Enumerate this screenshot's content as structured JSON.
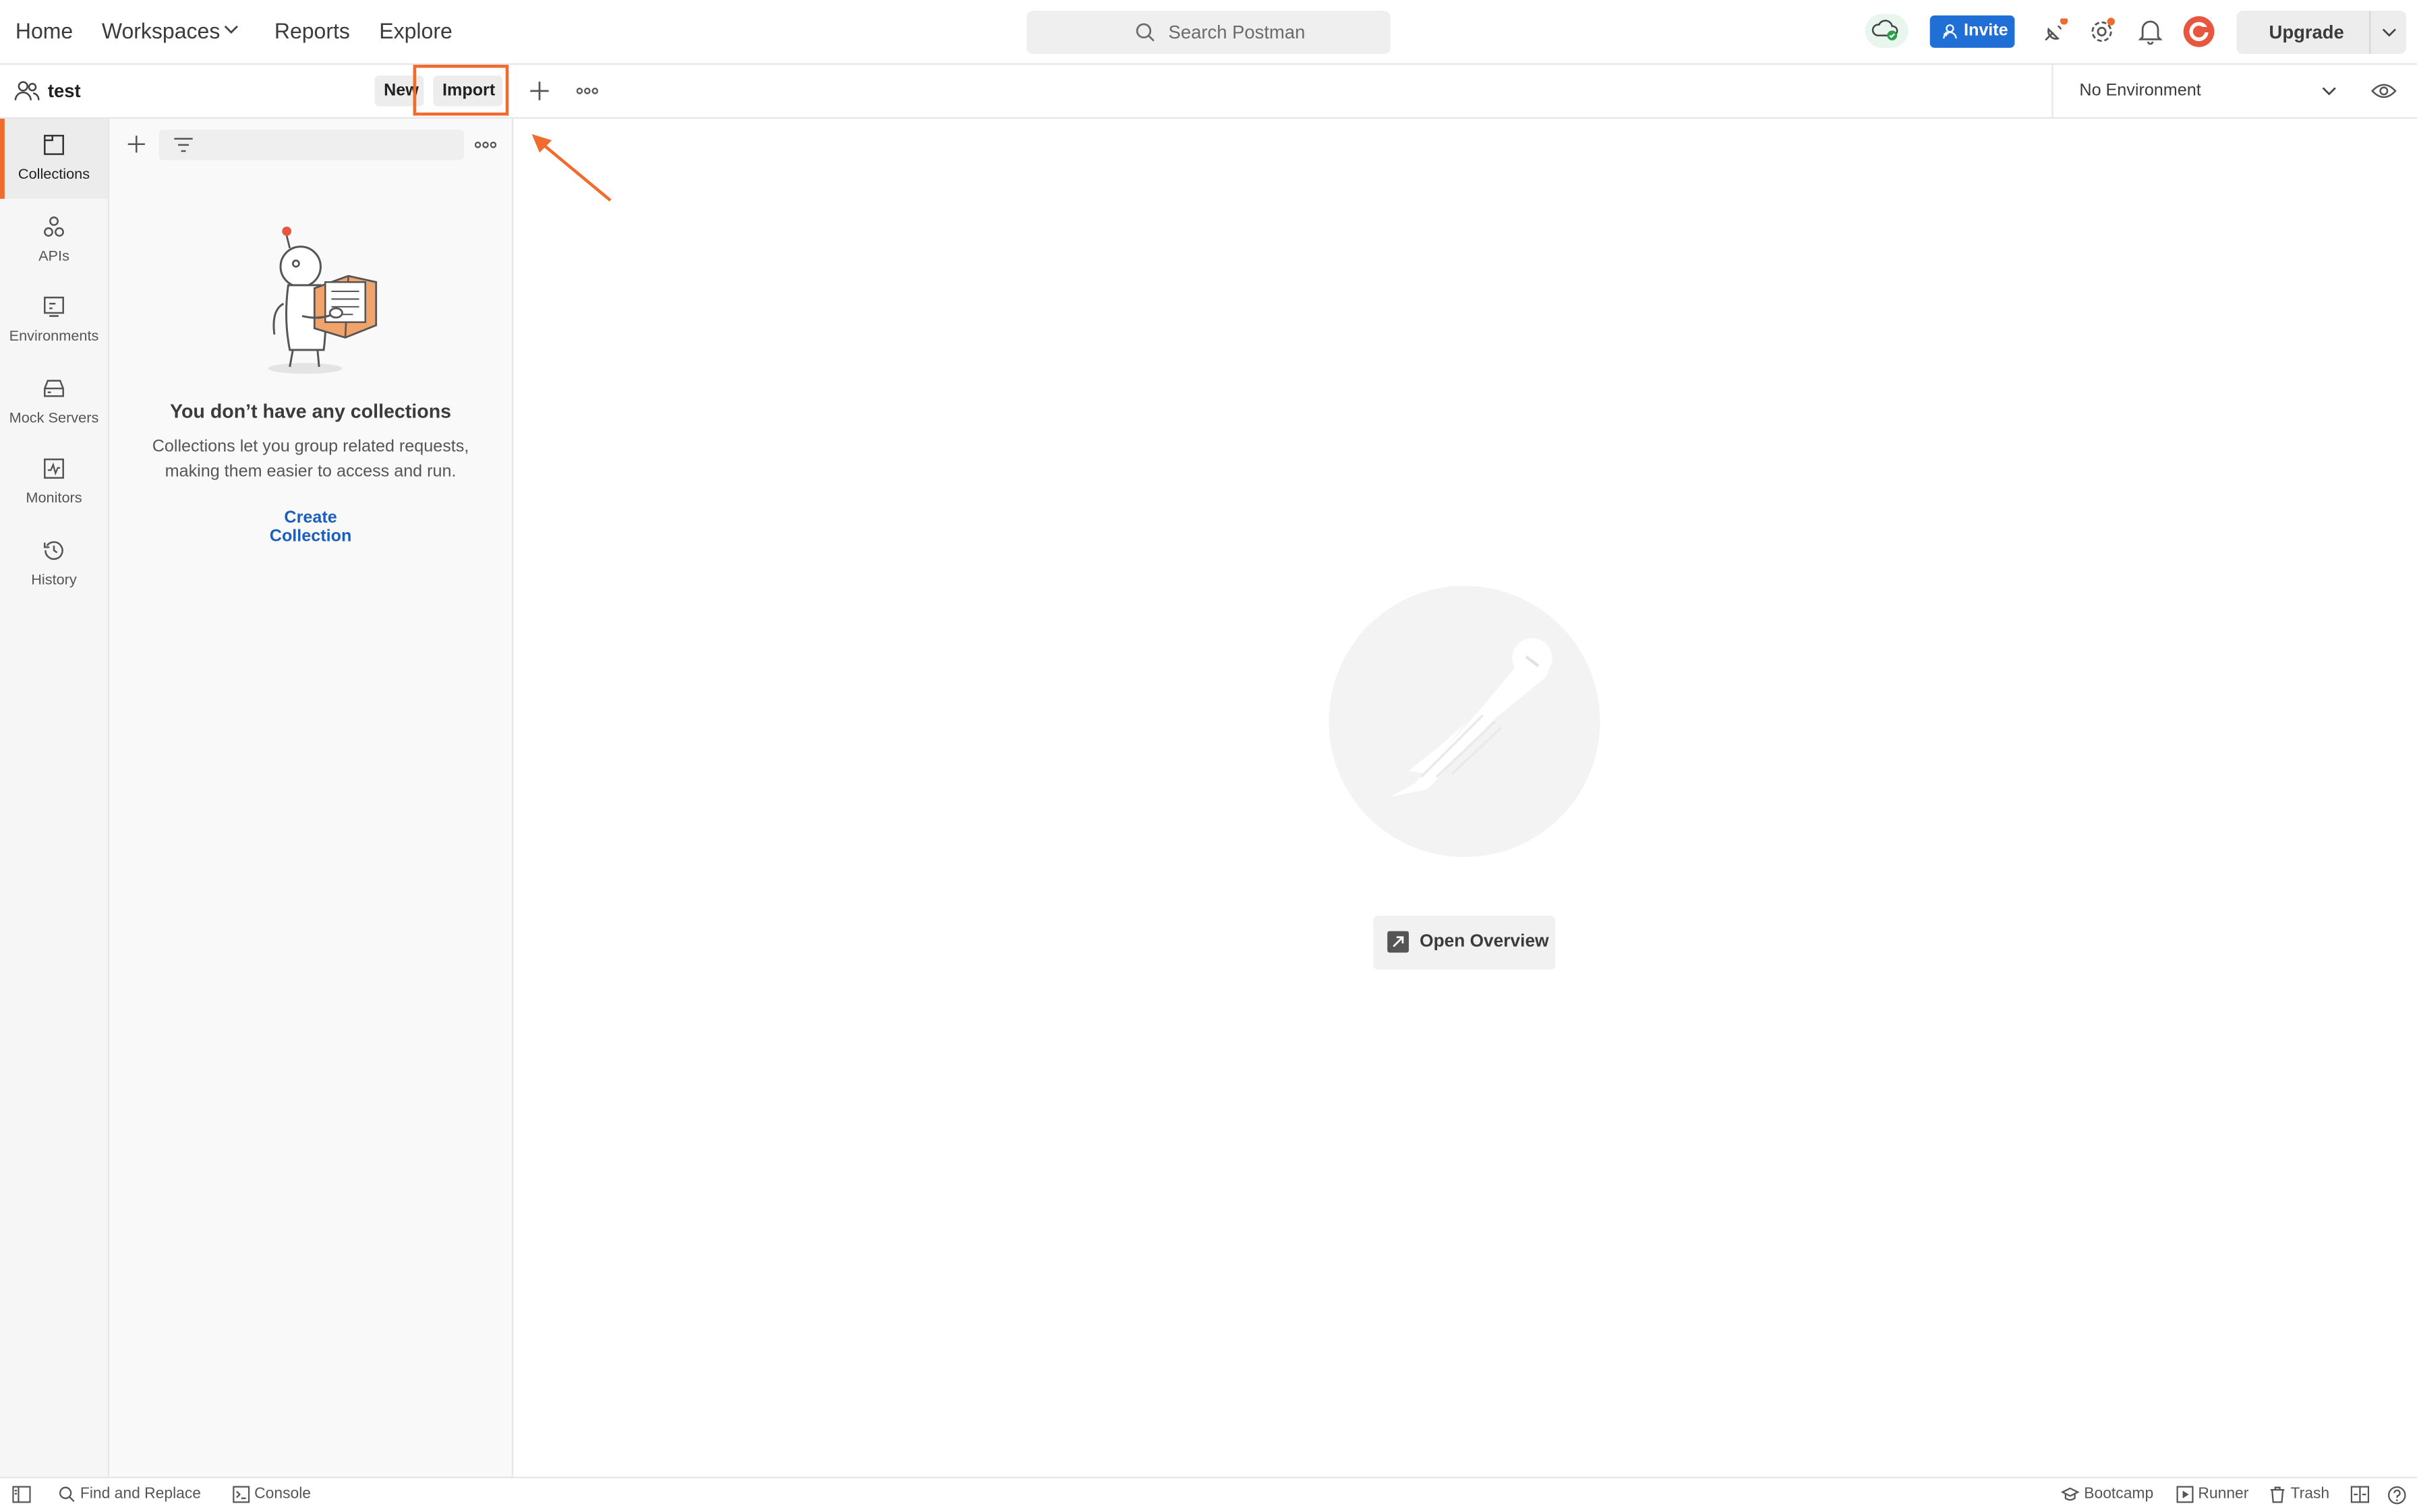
{
  "header": {
    "nav": {
      "home": "Home",
      "workspaces": "Workspaces",
      "reports": "Reports",
      "explore": "Explore"
    },
    "search_placeholder": "Search Postman",
    "invite_label": "Invite",
    "upgrade_label": "Upgrade"
  },
  "workspace": {
    "name": "test",
    "new_label": "New",
    "import_label": "Import",
    "environment": "No Environment"
  },
  "rail": {
    "items": [
      {
        "label": "Collections",
        "icon": "collections-icon",
        "active": true
      },
      {
        "label": "APIs",
        "icon": "apis-icon",
        "active": false
      },
      {
        "label": "Environments",
        "icon": "environments-icon",
        "active": false
      },
      {
        "label": "Mock Servers",
        "icon": "mock-servers-icon",
        "active": false
      },
      {
        "label": "Monitors",
        "icon": "monitors-icon",
        "active": false
      },
      {
        "label": "History",
        "icon": "history-icon",
        "active": false
      }
    ]
  },
  "sidebar": {
    "empty_title": "You don’t have any collections",
    "empty_line1": "Collections let you group related requests,",
    "empty_line2": "making them easier to access and run.",
    "create_label": "Create Collection"
  },
  "main": {
    "open_overview_label": "Open Overview"
  },
  "status": {
    "find_replace": "Find and Replace",
    "console": "Console",
    "bootcamp": "Bootcamp",
    "runner": "Runner",
    "trash": "Trash"
  },
  "colors": {
    "accent_orange": "#ef6c2e",
    "invite_blue": "#1f6fd6",
    "link_blue": "#1a5fbf",
    "sync_green": "#2e9e4f"
  }
}
